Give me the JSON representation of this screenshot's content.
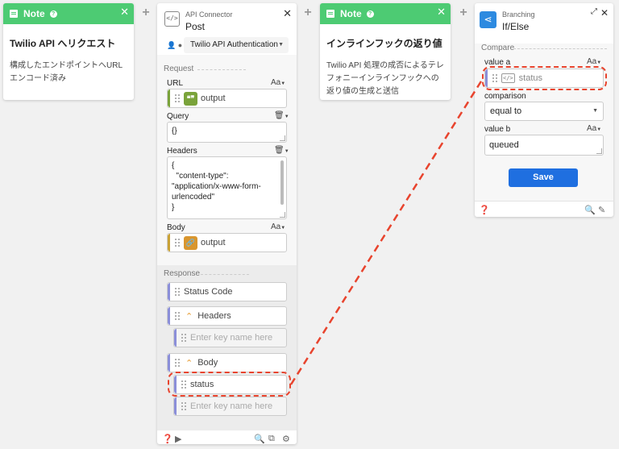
{
  "note1": {
    "header": "Note",
    "title": "Twilio API へリクエスト",
    "body": "構成したエンドポイントへURLエンコード済み"
  },
  "note2": {
    "header": "Note",
    "title": "インラインフックの返り値",
    "body": "Twilio API 処理の成否によるテレフォニーインラインフックへの返り値の生成と送信"
  },
  "api": {
    "subtitle": "API Connector",
    "title": "Post",
    "auth": "Twilio API Authentication",
    "request_label": "Request",
    "url_label": "URL",
    "url_value": "output",
    "query_label": "Query",
    "query_value": "{}",
    "headers_label": "Headers",
    "headers_value": "{\n  \"content-type\":\n\"application/x-www-form-\nurlencoded\"\n}",
    "body_label": "Body",
    "body_value": "output",
    "response_label": "Response",
    "status_code": "Status Code",
    "resp_headers": "Headers",
    "headers_placeholder": "Enter key name here",
    "resp_body": "Body",
    "body_status": "status",
    "body_placeholder": "Enter key name here"
  },
  "branch": {
    "subtitle": "Branching",
    "title": "If/Else",
    "compare_label": "Compare",
    "value_a_label": "value a",
    "value_a": "status",
    "comparison_label": "comparison",
    "comparison": "equal to",
    "value_b_label": "value b",
    "value_b": "queued",
    "save": "Save"
  },
  "aa_label": "Aa",
  "colors": {
    "note_green": "#4dcb73",
    "accent_blue": "#1f6fe0",
    "highlight_red": "#e8442e",
    "text_chip_green": "#7aa33a",
    "link_chip_orange": "#d9962e",
    "bar_purple": "#8b8fd9",
    "bar_gold": "#c9a236"
  },
  "icons": [
    "note-icon",
    "help-icon",
    "close-icon",
    "plus-icon",
    "code-icon",
    "user-icon",
    "share-icon",
    "expand-icon",
    "trash-icon",
    "chevron-up-icon",
    "search-icon",
    "copy-icon",
    "gear-icon",
    "play-icon",
    "pencil-icon"
  ]
}
